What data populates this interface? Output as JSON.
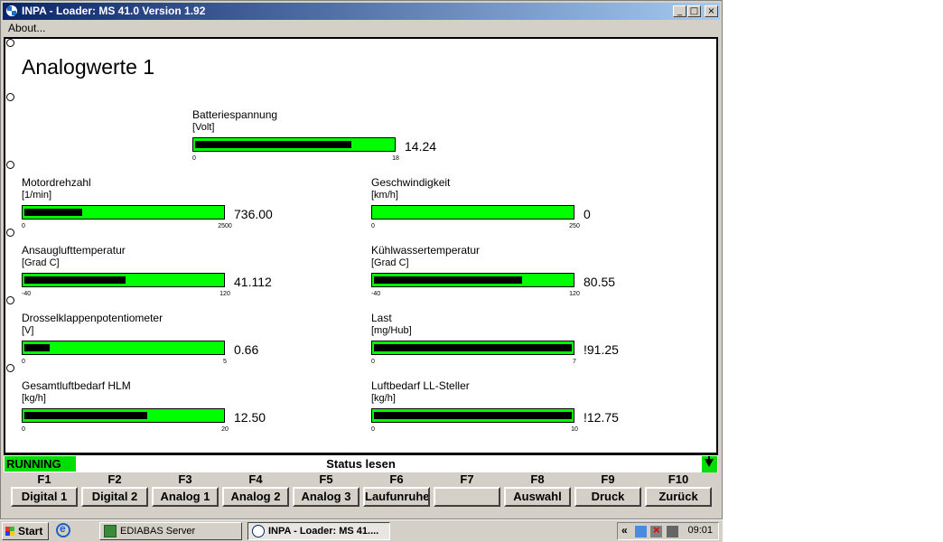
{
  "window": {
    "title": "INPA - Loader:  MS 41.0 Version 1.92",
    "minimize": "_",
    "maximize": "□",
    "close": "×"
  },
  "menu": {
    "about": "About..."
  },
  "page": {
    "title": "Analogwerte 1"
  },
  "gauges": [
    {
      "name": "Batteriespannung",
      "unit": "[Volt]",
      "value": "14.24",
      "min": "0",
      "max": "18",
      "fill_fraction": 0.79
    },
    {
      "name": "Motordrehzahl",
      "unit": "[1/min]",
      "value": "736.00",
      "min": "0",
      "max": "2500",
      "fill_fraction": 0.29
    },
    {
      "name": "Geschwindigkeit",
      "unit": "[km/h]",
      "value": "0",
      "min": "0",
      "max": "250",
      "fill_fraction": 0.0
    },
    {
      "name": "Ansauglufttemperatur",
      "unit": "[Grad C]",
      "value": "41.112",
      "min": "-40",
      "max": "120",
      "fill_fraction": 0.51
    },
    {
      "name": "Kühlwassertemperatur",
      "unit": "[Grad C]",
      "value": "80.55",
      "min": "-40",
      "max": "120",
      "fill_fraction": 0.75
    },
    {
      "name": "Drosselklappenpotentiometer",
      "unit": "[V]",
      "value": "0.66",
      "min": "0",
      "max": "5",
      "fill_fraction": 0.13
    },
    {
      "name": "Last",
      "unit": "[mg/Hub]",
      "value": "!91.25",
      "min": "0",
      "max": "7",
      "fill_fraction": 1.0
    },
    {
      "name": "Gesamtluftbedarf HLM",
      "unit": "[kg/h]",
      "value": "12.50",
      "min": "0",
      "max": "20",
      "fill_fraction": 0.62
    },
    {
      "name": "Luftbedarf LL-Steller",
      "unit": "[kg/h]",
      "value": "!12.75",
      "min": "0",
      "max": "10",
      "fill_fraction": 1.0
    }
  ],
  "status": {
    "state": "RUNNING",
    "text": "Status lesen",
    "state_color": "#00dd00"
  },
  "fkeys": [
    {
      "key": "F1",
      "label": "Digital 1"
    },
    {
      "key": "F2",
      "label": "Digital 2"
    },
    {
      "key": "F3",
      "label": "Analog 1"
    },
    {
      "key": "F4",
      "label": "Analog 2"
    },
    {
      "key": "F5",
      "label": "Analog 3"
    },
    {
      "key": "F6",
      "label": "Laufunruhe"
    },
    {
      "key": "F7",
      "label": ""
    },
    {
      "key": "F8",
      "label": "Auswahl"
    },
    {
      "key": "F9",
      "label": "Druck"
    },
    {
      "key": "F10",
      "label": "Zurück"
    }
  ],
  "colors": {
    "bar_green": "#00ff00",
    "title_blue": "#0a246a"
  },
  "taskbar": {
    "start": "Start",
    "tasks": [
      "EDIABAS Server",
      "INPA - Loader:  MS 41...."
    ],
    "tray_chevron": "«",
    "clock": "09:01"
  }
}
